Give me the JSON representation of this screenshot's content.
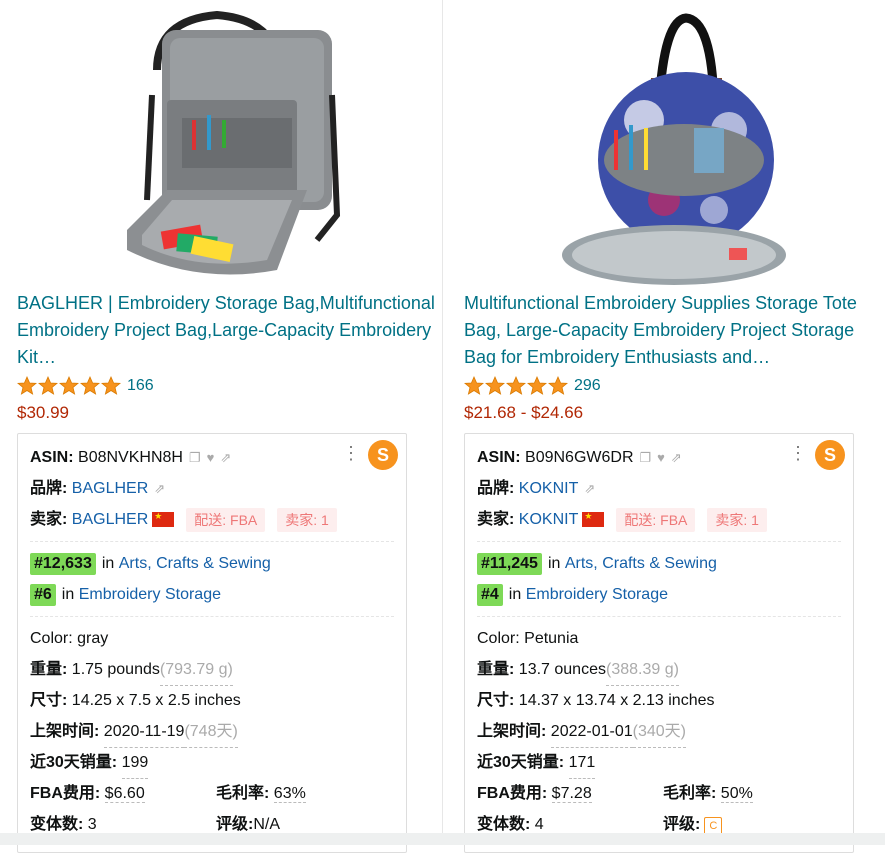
{
  "products": [
    {
      "title": "BAGLHER | Embroidery Storage Bag,Multifunctional Embroidery Project Bag,Large-Capacity Embroidery Kit…",
      "rating_count": "166",
      "price": "$30.99",
      "asin_label": "ASIN:",
      "asin": "B08NVKHN8H",
      "brand_label": "品牌:",
      "brand": "BAGLHER",
      "seller_label": "卖家:",
      "seller": "BAGLHER",
      "shipping_chip": "配送: FBA",
      "sellers_chip": "卖家: 1",
      "rank1": "#12,633",
      "rank1_in": "in",
      "rank1_cat": "Arts, Crafts & Sewing",
      "rank2": "#6",
      "rank2_in": "in",
      "rank2_cat": "Embroidery Storage",
      "color_label": "Color:",
      "color": "gray",
      "weight_label": "重量:",
      "weight": "1.75 pounds",
      "weight_g": "(793.79 g)",
      "size_label": "尺寸:",
      "size": "14.25 x 7.5 x 2.5 inches",
      "listed_label": "上架时间:",
      "listed": "2020-11-19",
      "listed_days": "(748天)",
      "sales_label": "近30天销量:",
      "sales": "199",
      "fba_label": "FBA费用:",
      "fba": "$6.60",
      "margin_label": "毛利率:",
      "margin": "63%",
      "variants_label": "变体数:",
      "variants": "3",
      "grade_label": "评级:",
      "grade": "N/A"
    },
    {
      "title": "Multifunctional Embroidery Supplies Storage Tote Bag, Large-Capacity Embroidery Project Storage Bag for Embroidery Enthusiasts and…",
      "rating_count": "296",
      "price": "$21.68 - $24.66",
      "asin_label": "ASIN:",
      "asin": "B09N6GW6DR",
      "brand_label": "品牌:",
      "brand": "KOKNIT",
      "seller_label": "卖家:",
      "seller": "KOKNIT",
      "shipping_chip": "配送: FBA",
      "sellers_chip": "卖家: 1",
      "rank1": "#11,245",
      "rank1_in": "in",
      "rank1_cat": "Arts, Crafts & Sewing",
      "rank2": "#4",
      "rank2_in": "in",
      "rank2_cat": "Embroidery Storage",
      "color_label": "Color:",
      "color": "Petunia",
      "weight_label": "重量:",
      "weight": "13.7 ounces",
      "weight_g": "(388.39 g)",
      "size_label": "尺寸:",
      "size": "14.37 x 13.74 x 2.13 inches",
      "listed_label": "上架时间:",
      "listed": "2022-01-01",
      "listed_days": "(340天)",
      "sales_label": "近30天销量:",
      "sales": "171",
      "fba_label": "FBA费用:",
      "fba": "$7.28",
      "margin_label": "毛利率:",
      "margin": "50%",
      "variants_label": "变体数:",
      "variants": "4",
      "grade_label": "评级:",
      "grade": "C"
    }
  ],
  "colors": {
    "link": "#007185",
    "price": "#b12704",
    "rank_badge": "#7ed957",
    "star": "#f7931e"
  },
  "icons": [
    "copy-icon",
    "heart-icon",
    "share-icon",
    "more-icon",
    "logo-icon",
    "china-flag-icon",
    "star-icon"
  ]
}
